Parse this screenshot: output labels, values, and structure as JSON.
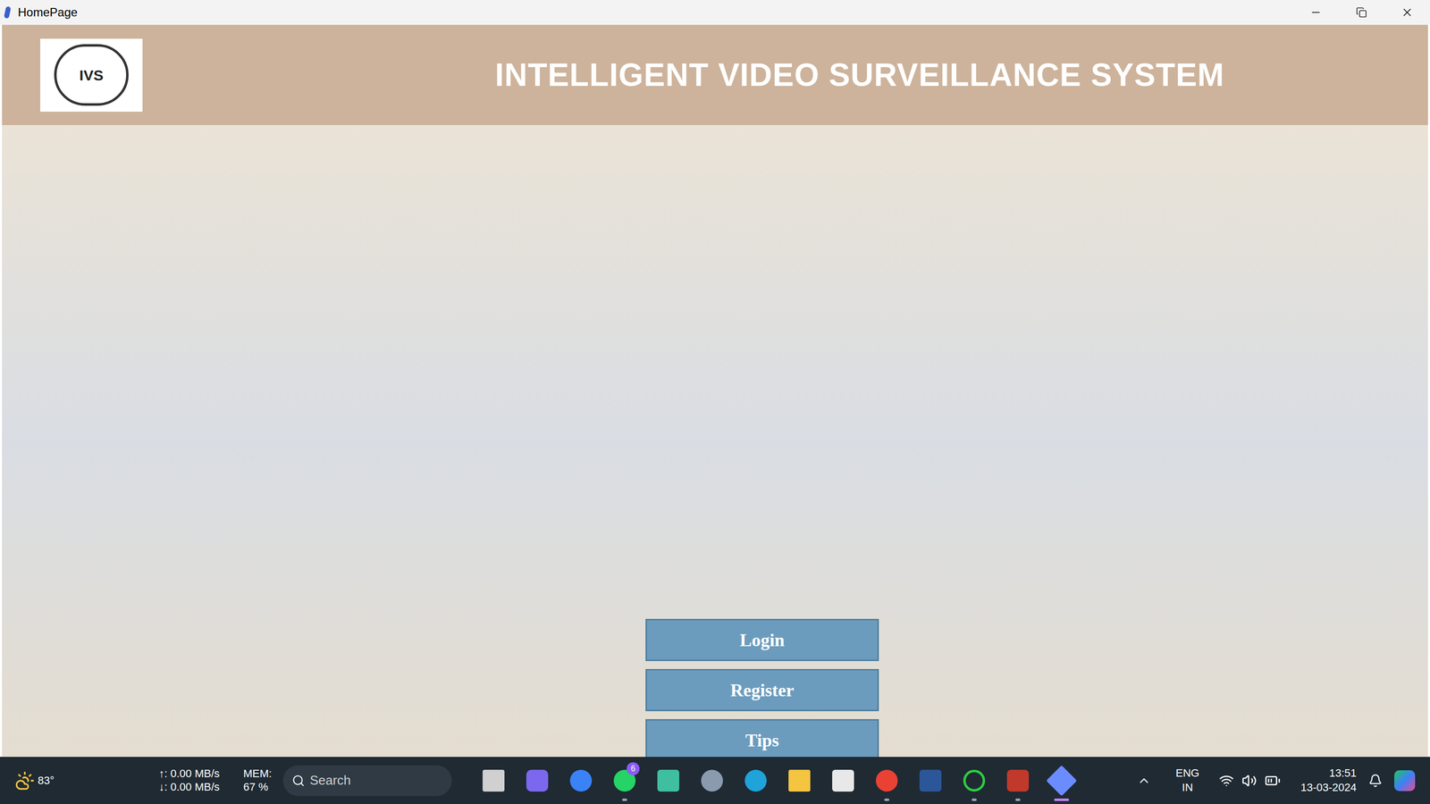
{
  "window": {
    "title": "HomePage"
  },
  "header": {
    "logo_text": "IVS",
    "title": "INTELLIGENT VIDEO SURVEILLANCE SYSTEM"
  },
  "buttons": [
    "Login",
    "Register",
    "Tips"
  ],
  "taskbar": {
    "weather": "83°",
    "net_up": "↑: 0.00 MB/s",
    "net_down": "↓: 0.00 MB/s",
    "mem_label": "MEM:",
    "mem_value": "67 %",
    "search_placeholder": "Search",
    "apps": [
      {
        "badge": "",
        "running": false,
        "active": false
      },
      {
        "badge": "",
        "running": false,
        "active": false
      },
      {
        "badge": "",
        "running": false,
        "active": false
      },
      {
        "badge": "6",
        "running": true,
        "active": false
      },
      {
        "badge": "",
        "running": false,
        "active": false
      },
      {
        "badge": "",
        "running": false,
        "active": false
      },
      {
        "badge": "",
        "running": false,
        "active": false
      },
      {
        "badge": "",
        "running": false,
        "active": false
      },
      {
        "badge": "",
        "running": false,
        "active": false
      },
      {
        "badge": "",
        "running": true,
        "active": false
      },
      {
        "badge": "",
        "running": false,
        "active": false
      },
      {
        "badge": "",
        "running": true,
        "active": false
      },
      {
        "badge": "",
        "running": true,
        "active": false
      },
      {
        "badge": "",
        "running": true,
        "active": true
      }
    ],
    "lang": "ENG",
    "region": "IN",
    "time": "13:51",
    "date": "13-03-2024"
  }
}
